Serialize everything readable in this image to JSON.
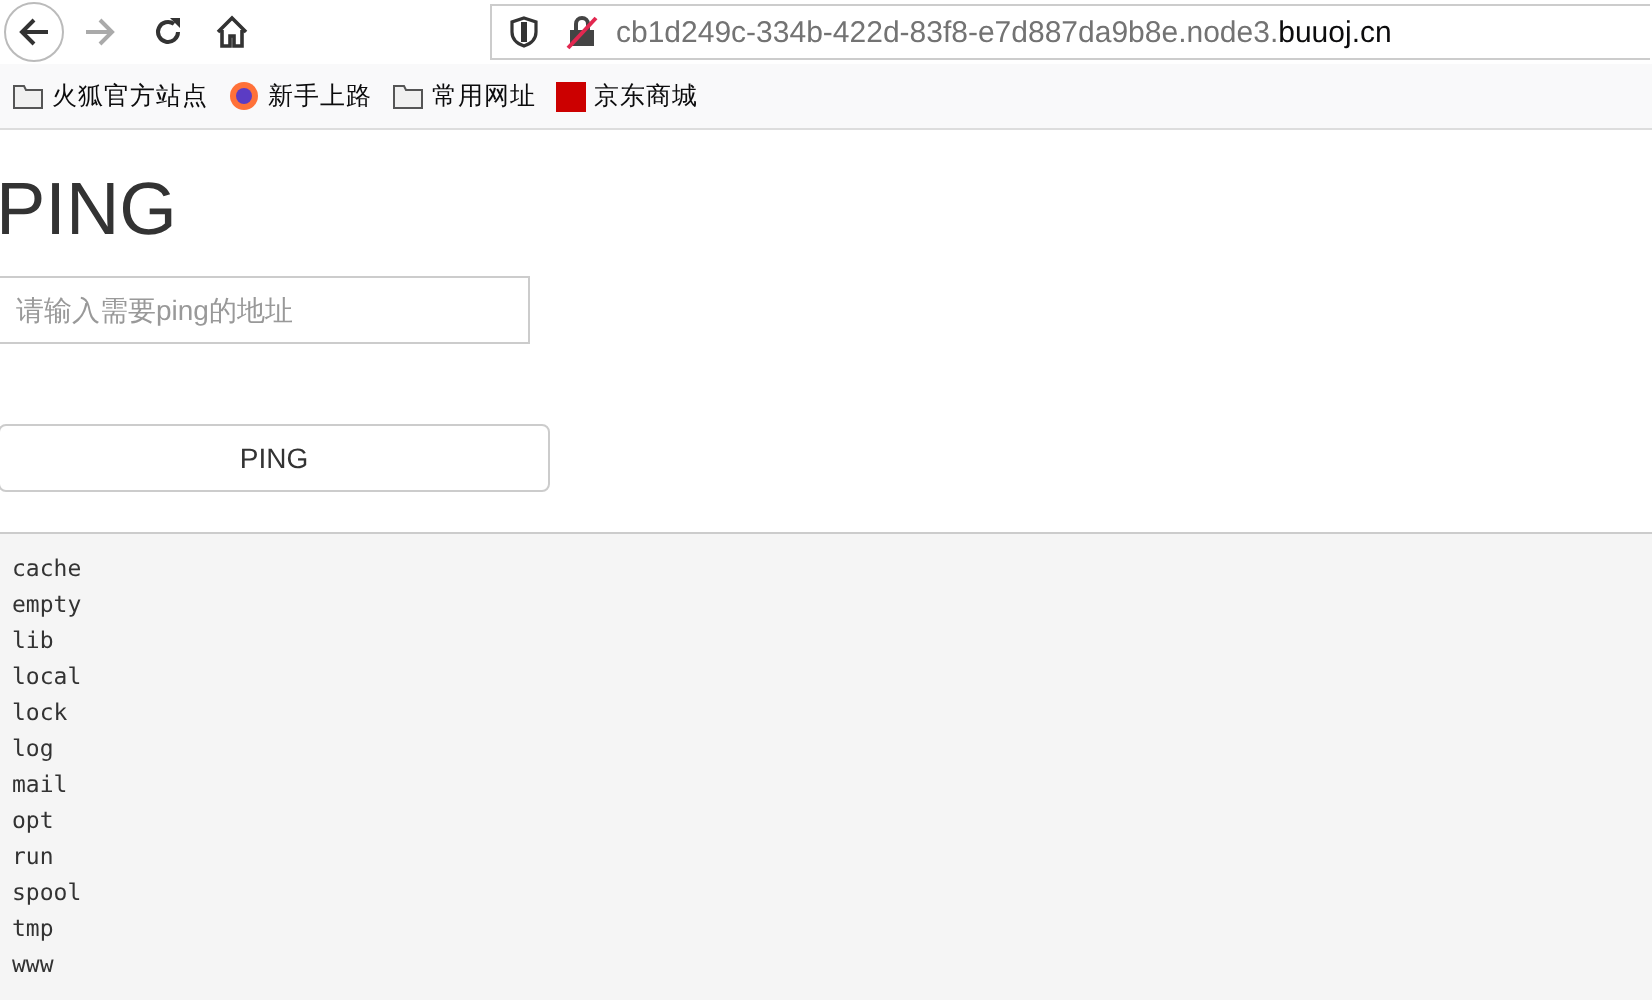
{
  "browser": {
    "url_host": "cb1d249c-334b-422d-83f8-e7d887da9b8e.node3.",
    "url_domain": "buuoj.cn",
    "bookmarks": [
      {
        "kind": "folder",
        "label": "火狐官方站点"
      },
      {
        "kind": "firefox",
        "label": "新手上路"
      },
      {
        "kind": "folder",
        "label": "常用网址"
      },
      {
        "kind": "jd",
        "label": "京东商城"
      }
    ]
  },
  "page": {
    "title": "PING",
    "input": {
      "placeholder": "请输入需要ping的地址"
    },
    "button": "PING",
    "output": [
      "cache",
      "empty",
      "lib",
      "local",
      "lock",
      "log",
      "mail",
      "opt",
      "run",
      "spool",
      "tmp",
      "www"
    ]
  }
}
